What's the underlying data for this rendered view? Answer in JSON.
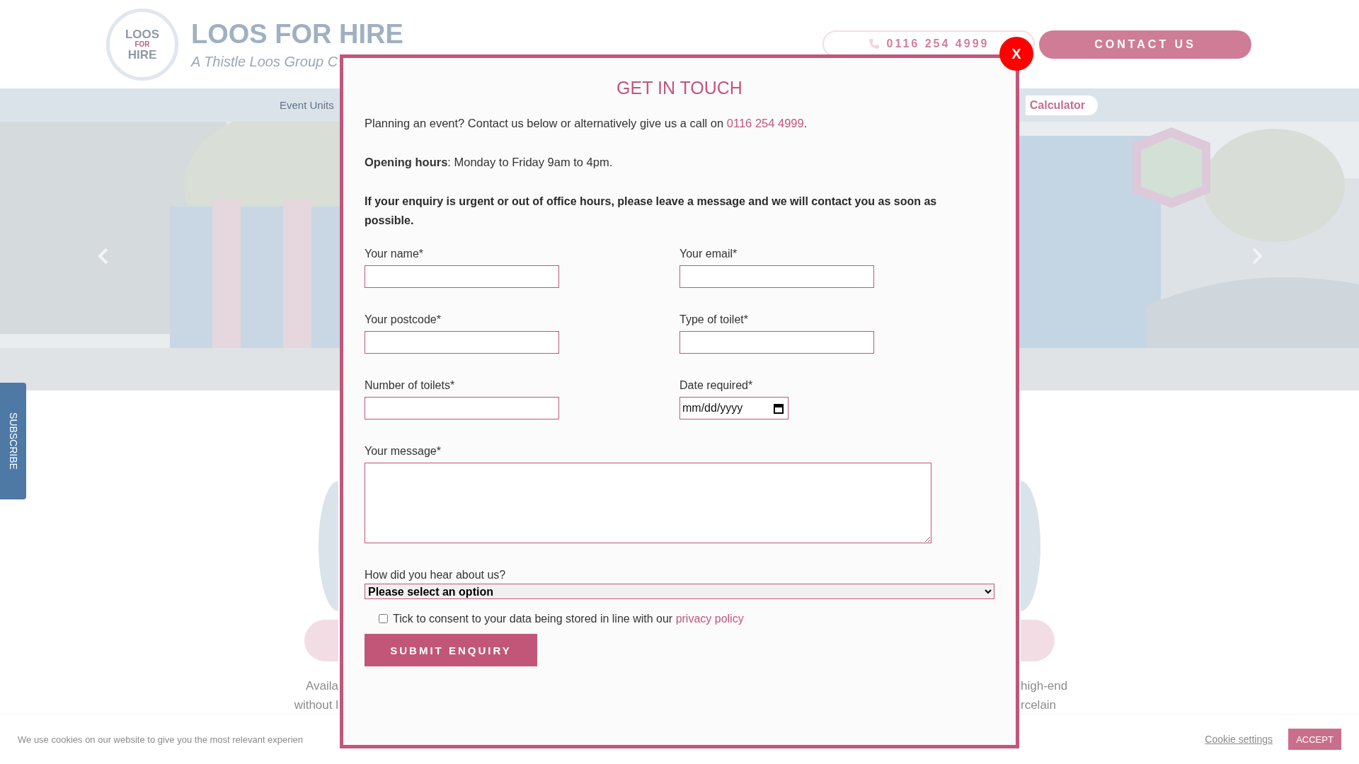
{
  "header": {
    "logo": [
      "LOOS",
      "FOR",
      "HIRE"
    ],
    "brand": "LOOS FOR HIRE",
    "tagline": "A Thistle Loos Group C",
    "phone_button": "0116 254 4999",
    "contact_button": "CONTACT US"
  },
  "nav": [
    {
      "label": "Event Units",
      "kind": "link"
    },
    {
      "label": "Calculator",
      "kind": "pill"
    }
  ],
  "subscribe_tab": "SUBSCRIBE",
  "features": {
    "left_lines": [
      "Availa",
      "without l"
    ],
    "right_lines": [
      "high-end",
      "rcelain"
    ]
  },
  "cookie_bar": {
    "text": "We use cookies on our website to give you the most relevant experien",
    "settings_link": "Cookie settings",
    "accept_button": "ACCEPT"
  },
  "modal": {
    "close": "X",
    "title": "GET IN TOUCH",
    "intro": "Planning an event? Contact us below or alternatively give us a call on ",
    "intro_phone": "0116 254 4999",
    "intro_end": ".",
    "hours": "**Opening hours**: Monday to Friday 9am to 4pm.",
    "urgent": "If your enquiry is urgent or out of office hours, please leave a message and we will contact you as soon as possible.",
    "fields": [
      {
        "label": "Your name*",
        "kind": "text"
      },
      {
        "label": "Your email*",
        "kind": "text"
      },
      {
        "label": "Your postcode*",
        "kind": "text"
      },
      {
        "label": "Type of toilet*",
        "kind": "text"
      },
      {
        "label": "Number of toilets*",
        "kind": "text"
      },
      {
        "label": "Date required*",
        "kind": "date",
        "placeholder": "mm/dd/yyyy"
      }
    ],
    "message": {
      "label": "Your message*"
    },
    "source": {
      "label": "How did you hear about us?",
      "value": "Please select an option"
    },
    "consent": {
      "text": "Tick to consent to your data being stored in line with our ",
      "link": "privacy policy",
      "checked": false
    },
    "submit": "SUBMIT ENQUIRY"
  }
}
